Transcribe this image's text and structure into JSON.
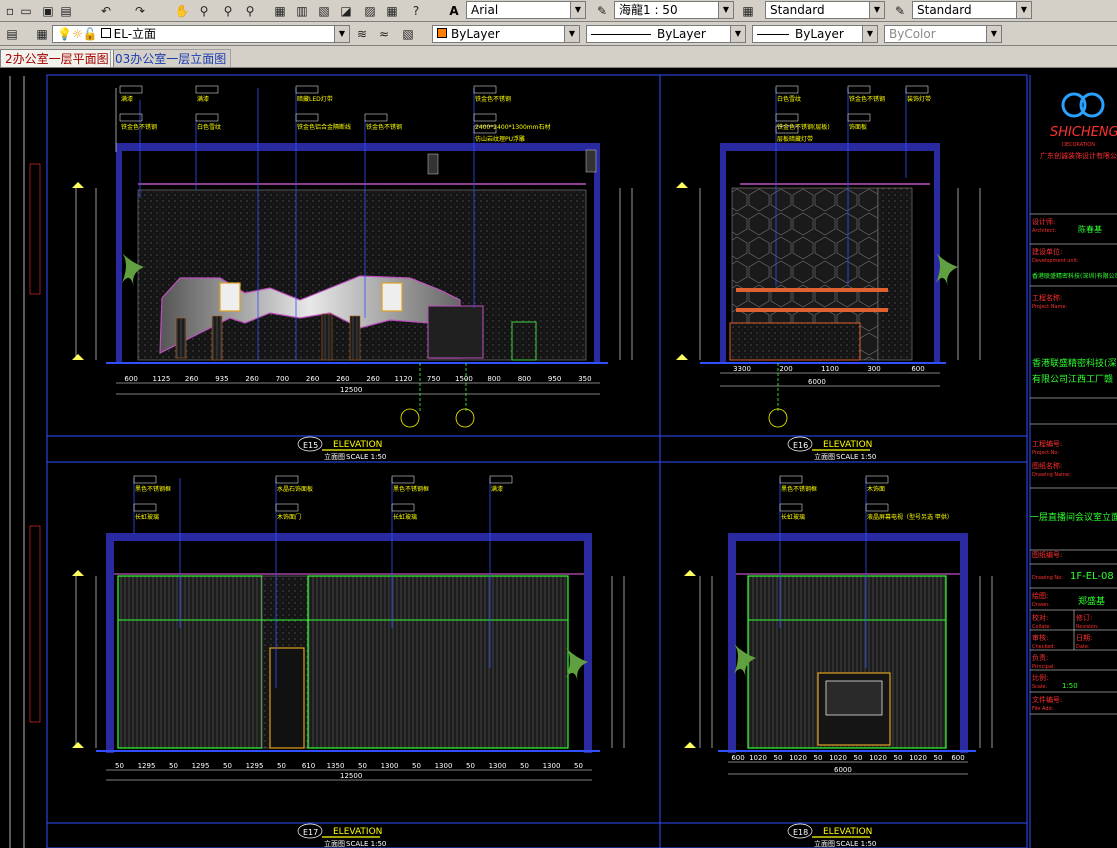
{
  "toolbar1": {
    "font_combo": "Arial",
    "scale_combo": "海龍1 : 50",
    "dim_style_combo": "Standard",
    "table_style_combo": "Standard"
  },
  "toolbar2": {
    "layer_combo": "EL-立面",
    "color_combo": "ByLayer",
    "linetype_combo": "ByLayer",
    "lineweight_combo": "ByLayer",
    "plotstyle_combo": "ByColor"
  },
  "tabs": [
    {
      "label": "2办公室一层平面图"
    },
    {
      "label": "03办公室一层立面图"
    }
  ],
  "drawing": {
    "elevations": [
      {
        "code": "E15",
        "title": "ELEVATION",
        "subtitle": "立面图",
        "scale": "SCALE 1:50",
        "dims": [
          "600",
          "1125",
          "260",
          "935",
          "260",
          "700",
          "260",
          "260",
          "260",
          "1120",
          "750",
          "1500",
          "800",
          "800",
          "950",
          "350"
        ],
        "total": "12500",
        "tags": [
          "满漆",
          "满漆",
          "暗藏LED灯带",
          "铁金色不锈钢",
          "铁金色不锈钢",
          "白色雪纹",
          "铁金色铝合金隔断线",
          "铁金色不锈钢",
          "2400*2400*1300mm石材",
          "仿山岩纹理PU浮雕"
        ]
      },
      {
        "code": "E16",
        "title": "ELEVATION",
        "subtitle": "立面图",
        "scale": "SCALE 1:50",
        "dims": [
          "3300",
          "200",
          "1100",
          "300",
          "600"
        ],
        "total": "6000",
        "tags": [
          "白色雪纹",
          "铁金色不锈钢",
          "装饰灯带",
          "铁金色不锈钢(层板)",
          "层板暗藏灯带",
          "饰面板"
        ]
      },
      {
        "code": "E17",
        "title": "ELEVATION",
        "subtitle": "立面图",
        "scale": "SCALE 1:50",
        "dims": [
          "50",
          "1295",
          "50",
          "1295",
          "50",
          "1295",
          "50",
          "610",
          "1350",
          "50",
          "1300",
          "50",
          "1300",
          "50",
          "1300",
          "50",
          "1300",
          "50"
        ],
        "total": "12500",
        "tags": [
          "黑色不锈钢框",
          "水晶石饰面板",
          "黑色不锈钢框",
          "满漆",
          "长虹玻璃",
          "木饰面门",
          "长虹玻璃"
        ]
      },
      {
        "code": "E18",
        "title": "ELEVATION",
        "subtitle": "立面图",
        "scale": "SCALE 1:50",
        "dims": [
          "600",
          "1020",
          "50",
          "1020",
          "50",
          "1020",
          "50",
          "1020",
          "50",
          "1020",
          "50",
          "600"
        ],
        "total": "6000",
        "tags": [
          "黑色不锈钢框",
          "木饰面",
          "长虹玻璃",
          "液晶屏幕电视（型号另选 甲供）"
        ]
      }
    ],
    "title_block": {
      "company_logo": "SHICHENG",
      "company_sub": "DECORATION",
      "company_name": "广东创诚装饰设计有限公司",
      "designer_label": "设计师:",
      "designer_label_en": "Architect:",
      "designer": "陈春基",
      "dev_unit_label": "建设单位:",
      "dev_unit_label_en": "Development unit:",
      "dev_unit": "香港联盛精密科技(深圳)有限公司",
      "project_label": "工程名称:",
      "project_label_en": "Project Name:",
      "project_line1": "香港联盛精密科技(深",
      "project_line2": "有限公司江西工厂赣",
      "project_no_label": "工程编号:",
      "project_no_label_en": "Project No:",
      "drawing_name_label": "图纸名称:",
      "drawing_name_label_en": "Drawing Name:",
      "drawing_name": "一层直播间会议室立面",
      "drawing_no_label": "图纸编号:",
      "drawing_no_label_en": "Drawing No:",
      "drawing_no": "1F-EL-08",
      "drawn_label": "绘图:",
      "drawn_label_en": "Drawn:",
      "drawn_by": "郑盛基",
      "check_label": "校对:",
      "check_label_en": "Collate:",
      "revise_label": "修订:",
      "revise_label_en": "Revision:",
      "review_label": "审核:",
      "review_label_en": "Checked:",
      "date_label": "日期:",
      "date_label_en": "Date:",
      "principal_label": "负责:",
      "principal_label_en": "Principal:",
      "scale_label": "比例:",
      "scale_label_en": "Scale:",
      "scale_value": "1:50",
      "file_label": "文件编号:",
      "file_label_en": "File Add:"
    }
  }
}
